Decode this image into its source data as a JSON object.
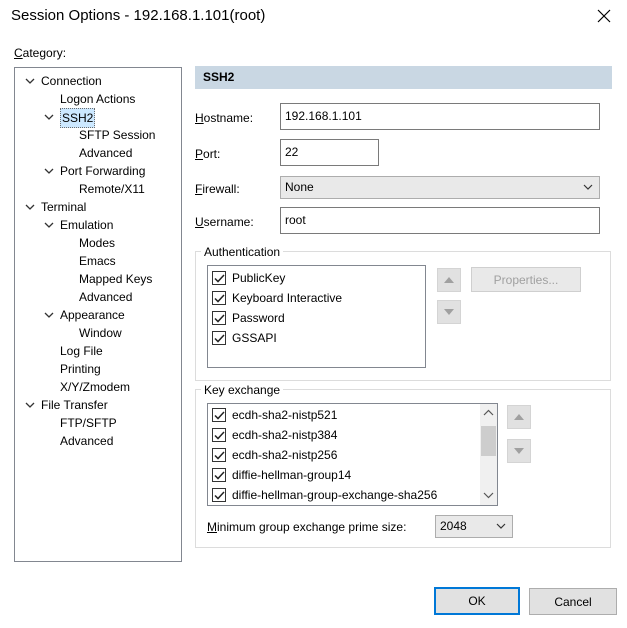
{
  "window": {
    "title": "Session Options - 192.168.1.101(root)"
  },
  "category_label": "Category:",
  "tree": [
    {
      "label": "Connection",
      "level": 0,
      "expanded": true
    },
    {
      "label": "Logon Actions",
      "level": 1
    },
    {
      "label": "SSH2",
      "level": 1,
      "expanded": true,
      "selected": true
    },
    {
      "label": "SFTP Session",
      "level": 2
    },
    {
      "label": "Advanced",
      "level": 2
    },
    {
      "label": "Port Forwarding",
      "level": 1,
      "expanded": true
    },
    {
      "label": "Remote/X11",
      "level": 2
    },
    {
      "label": "Terminal",
      "level": 0,
      "expanded": true
    },
    {
      "label": "Emulation",
      "level": 1,
      "expanded": true
    },
    {
      "label": "Modes",
      "level": 2
    },
    {
      "label": "Emacs",
      "level": 2
    },
    {
      "label": "Mapped Keys",
      "level": 2
    },
    {
      "label": "Advanced",
      "level": 2
    },
    {
      "label": "Appearance",
      "level": 1,
      "expanded": true
    },
    {
      "label": "Window",
      "level": 2
    },
    {
      "label": "Log File",
      "level": 1
    },
    {
      "label": "Printing",
      "level": 1
    },
    {
      "label": "X/Y/Zmodem",
      "level": 1
    },
    {
      "label": "File Transfer",
      "level": 0,
      "expanded": true
    },
    {
      "label": "FTP/SFTP",
      "level": 1
    },
    {
      "label": "Advanced",
      "level": 1
    }
  ],
  "section": {
    "title": "SSH2"
  },
  "form": {
    "hostname_label": "Hostname:",
    "hostname_value": "192.168.1.101",
    "port_label": "Port:",
    "port_value": "22",
    "firewall_label": "Firewall:",
    "firewall_value": "None",
    "username_label": "Username:",
    "username_value": "root"
  },
  "authentication": {
    "title": "Authentication",
    "items": [
      {
        "label": "PublicKey",
        "checked": true
      },
      {
        "label": "Keyboard Interactive",
        "checked": true
      },
      {
        "label": "Password",
        "checked": true
      },
      {
        "label": "GSSAPI",
        "checked": true
      }
    ],
    "properties_label": "Properties..."
  },
  "key_exchange": {
    "title": "Key exchange",
    "items": [
      {
        "label": "ecdh-sha2-nistp521",
        "checked": true
      },
      {
        "label": "ecdh-sha2-nistp384",
        "checked": true
      },
      {
        "label": "ecdh-sha2-nistp256",
        "checked": true
      },
      {
        "label": "diffie-hellman-group14",
        "checked": true
      },
      {
        "label": "diffie-hellman-group-exchange-sha256",
        "checked": true
      }
    ],
    "min_group_label": "Minimum group exchange prime size:",
    "min_group_value": "2048"
  },
  "buttons": {
    "ok": "OK",
    "cancel": "Cancel"
  }
}
